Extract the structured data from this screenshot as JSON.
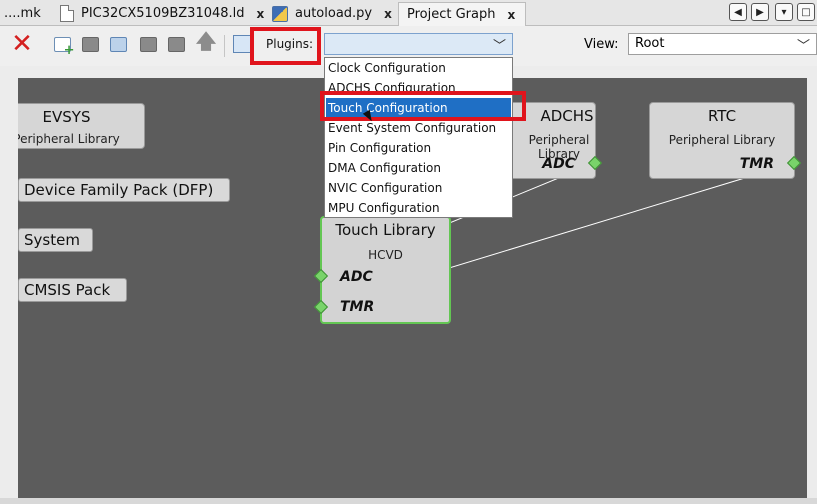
{
  "tabs": [
    {
      "label": "....mk",
      "closable": false,
      "icon": "none"
    },
    {
      "label": "PIC32CX5109BZ31048.ld",
      "closable": true,
      "icon": "document-icon"
    },
    {
      "label": "autoload.py",
      "closable": true,
      "icon": "python-icon"
    },
    {
      "label": "Project Graph",
      "closable": true,
      "icon": "none",
      "active": true
    }
  ],
  "tab_close_glyph": "x",
  "window_buttons": [
    "◀",
    "▶",
    "▾",
    "□"
  ],
  "toolbar": {
    "plugins_label": "Plugins:",
    "plugins_value": "",
    "view_label": "View:",
    "view_value": "Root",
    "icons": [
      "delete-icon",
      "add-component-icon",
      "component-icon",
      "import-icon",
      "component-icon",
      "export-icon",
      "up-arrow-icon",
      "fit-view-icon"
    ]
  },
  "plugins_dropdown": {
    "items": [
      "Clock Configuration",
      "ADCHS Configuration",
      "Touch Configuration",
      "Event System Configuration",
      "Pin Configuration",
      "DMA Configuration",
      "NVIC Configuration",
      "MPU Configuration"
    ],
    "selected_index": 2
  },
  "graph": {
    "nodes": {
      "evsys": {
        "title": "EVSYS",
        "subtitle": "Peripheral Library"
      },
      "adchs": {
        "title": "ADCHS",
        "subtitle": "Peripheral Library",
        "port": "ADC"
      },
      "rtc": {
        "title": "RTC",
        "subtitle": "Peripheral Library",
        "port": "TMR"
      },
      "touch": {
        "title": "Touch Library",
        "subtitle": "HCVD",
        "ports": [
          "ADC",
          "TMR"
        ]
      }
    },
    "pills": [
      "Device Family Pack (DFP)",
      "System",
      "CMSIS Pack"
    ]
  },
  "colors": {
    "canvas": "#5c5c5c",
    "highlight_box": "#e0141c",
    "selection": "#1f6fc5",
    "connector": "#79d36a",
    "touch_border": "#63c653"
  }
}
